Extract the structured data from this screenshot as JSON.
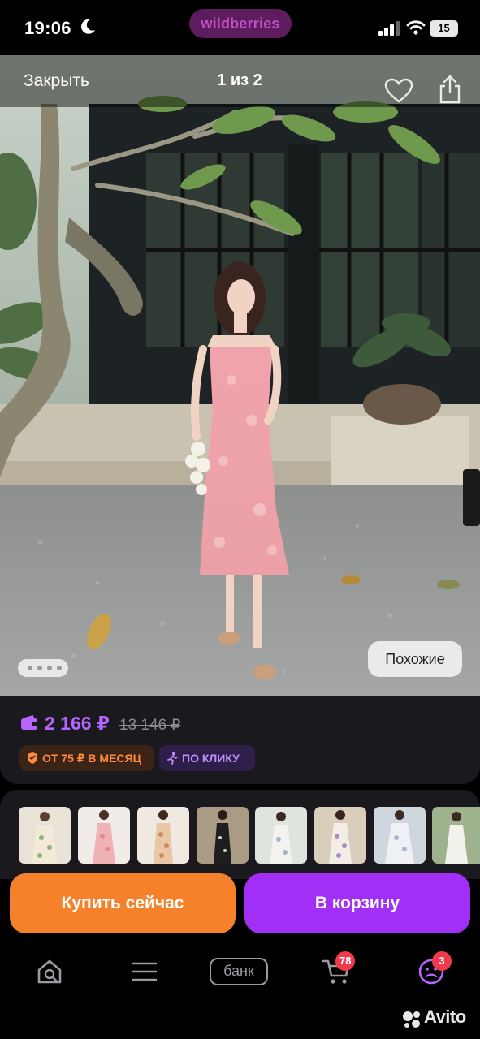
{
  "status_bar": {
    "time": "19:06",
    "brand": "wildberries",
    "battery": "15"
  },
  "viewer": {
    "close_label": "Закрыть",
    "counter": "1 из 2",
    "similar_label": "Похожие"
  },
  "product": {
    "price": "2 166 ₽",
    "old_price": "13 146 ₽",
    "installment_label": "ОТ 75 ₽ В МЕСЯЦ",
    "one_click_label": "ПО КЛИКУ"
  },
  "actions": {
    "buy_now": "Купить сейчас",
    "add_to_cart": "В корзину"
  },
  "nav": {
    "bank_label": "банк",
    "cart_badge": "78",
    "profile_badge": "3"
  },
  "watermark": "Avito",
  "colors": {
    "accent_purple": "#a12ff5",
    "accent_orange": "#f5822b",
    "badge_red": "#f23a4d",
    "price_purple": "#b765ff"
  }
}
